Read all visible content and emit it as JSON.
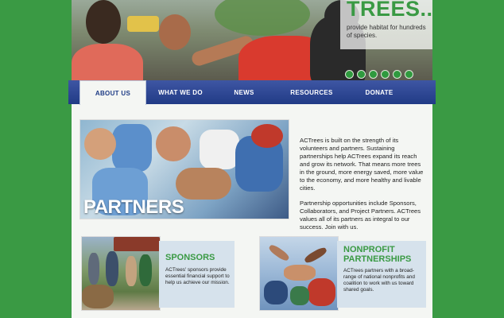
{
  "hero": {
    "heading": "TREES...",
    "subtext": "provide habitat for hundreds of species.",
    "dot_count": 6
  },
  "nav": {
    "items": [
      "ABOUT US",
      "WHAT WE DO",
      "NEWS",
      "RESOURCES",
      "DONATE"
    ],
    "active": "ABOUT US"
  },
  "main": {
    "partners_label": "PARTNERS",
    "intro_para1": "ACTrees is built on the strength of its volunteers and partners. Sustaining partnerships help ACTrees expand its reach and grow its network. That means more trees in the ground, more energy saved, more value to the economy, and more healthy and livable cities.",
    "intro_para2": "Partnership opportunities include Sponsors, Collaborators, and Project Partners. ACTrees values all of its partners as integral to our success. Join with us."
  },
  "cards": {
    "sponsors": {
      "title": "SPONSORS",
      "text": "ACTrees' sponsors provide essential financial support to help us achieve our mission."
    },
    "nonprofit": {
      "title_line1": "NONPROFIT",
      "title_line2": "PARTNERSHIPS",
      "text": "ACTrees partners with a broad-range of national nonprofits and coalition to work with us toward shared goals."
    }
  },
  "colors": {
    "background": "#3a9a44",
    "nav": "#213b86",
    "accent_green": "#3a9a44",
    "card_box": "#d6e2ec"
  }
}
